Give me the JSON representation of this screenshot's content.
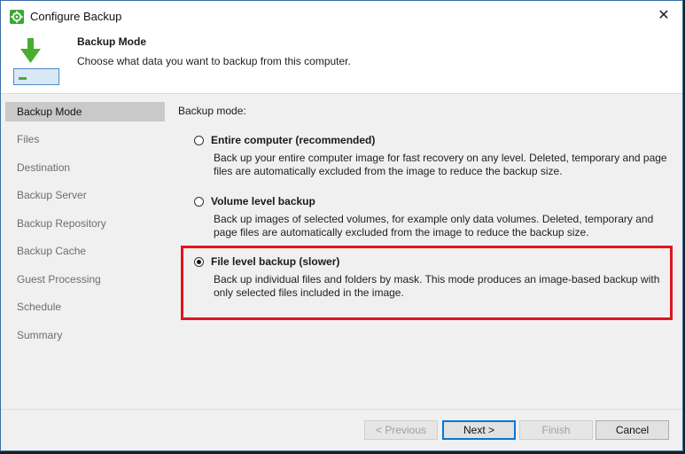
{
  "window": {
    "title": "Configure Backup",
    "close_glyph": "✕"
  },
  "header": {
    "title": "Backup Mode",
    "subtitle": "Choose what data you want to backup from this computer.",
    "icon": "download-arrow-disk-icon"
  },
  "sidebar": {
    "items": [
      {
        "label": "Backup Mode",
        "active": true
      },
      {
        "label": "Files"
      },
      {
        "label": "Destination"
      },
      {
        "label": "Backup Server"
      },
      {
        "label": "Backup Repository"
      },
      {
        "label": "Backup Cache"
      },
      {
        "label": "Guest Processing"
      },
      {
        "label": "Schedule"
      },
      {
        "label": "Summary"
      }
    ]
  },
  "main": {
    "label": "Backup mode:",
    "options": [
      {
        "title": "Entire computer (recommended)",
        "desc": "Back up your entire computer image for fast recovery on any level. Deleted, temporary and page files are automatically excluded from the image to reduce the backup size.",
        "selected": false
      },
      {
        "title": "Volume level backup",
        "desc": "Back up images of selected volumes, for example only data volumes. Deleted, temporary and page files are automatically excluded from the image to reduce the backup size.",
        "selected": false
      },
      {
        "title": "File level backup (slower)",
        "desc": "Back up individual files and folders by mask. This mode produces an image-based backup with only selected files included in the image.",
        "selected": true
      }
    ],
    "highlight_color": "#e0141e"
  },
  "footer": {
    "previous": "< Previous",
    "next": "Next >",
    "finish": "Finish",
    "cancel": "Cancel"
  }
}
